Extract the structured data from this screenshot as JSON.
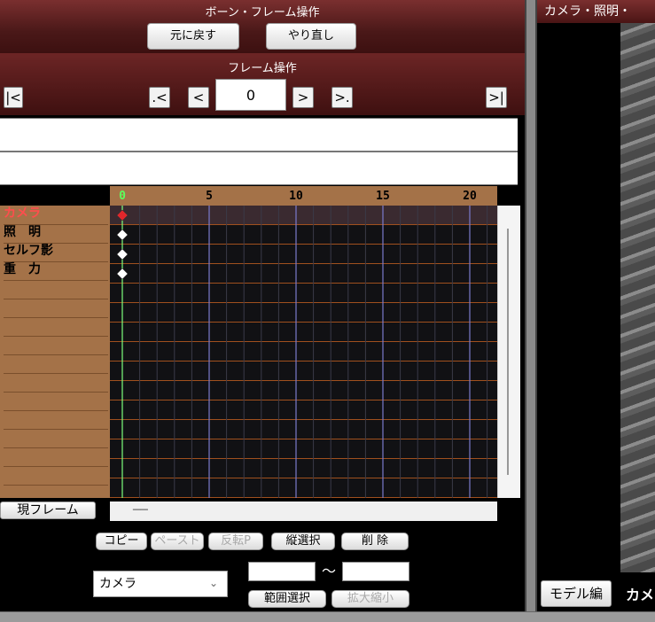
{
  "bone_frame_ops": {
    "title": "ボーン・フレーム操作",
    "undo_label": "元に戻す",
    "redo_label": "やり直し"
  },
  "frame_ops": {
    "title": "フレーム操作",
    "first_label": "|<",
    "prev_key_label": ".<",
    "prev_label": "<",
    "current_frame": "0",
    "next_label": ">",
    "next_key_label": ">.",
    "last_label": ">|"
  },
  "timeline": {
    "ticks": [
      "0",
      "5",
      "10",
      "15",
      "20"
    ],
    "tracks": [
      "カメラ",
      "照　明",
      "セルフ影",
      "重　力"
    ],
    "selected_track": "カメラ",
    "current_frame_label": "現フレーム",
    "current_frame_value": "──"
  },
  "edit_buttons": {
    "copy": "コピー",
    "paste": "ペースト",
    "reverse_paste": "反転P",
    "vertical_select": "縦選択",
    "delete": "削 除",
    "range_select": "範囲選択",
    "scale": "拡大縮小"
  },
  "target_select": {
    "value": "カメラ",
    "range_separator": "～",
    "range_from": "",
    "range_to": ""
  },
  "right_panel": {
    "header": "カメラ・照明・",
    "model_edit_label": "モデル編",
    "camera_tab_label": "カメ"
  },
  "colors": {
    "panel_header": "#5a1c1c",
    "track_label_bg": "#a47248",
    "active_track": "#ff4d4d",
    "keyframe_selected": "#e0262b",
    "keyframe": "#ffffff"
  }
}
